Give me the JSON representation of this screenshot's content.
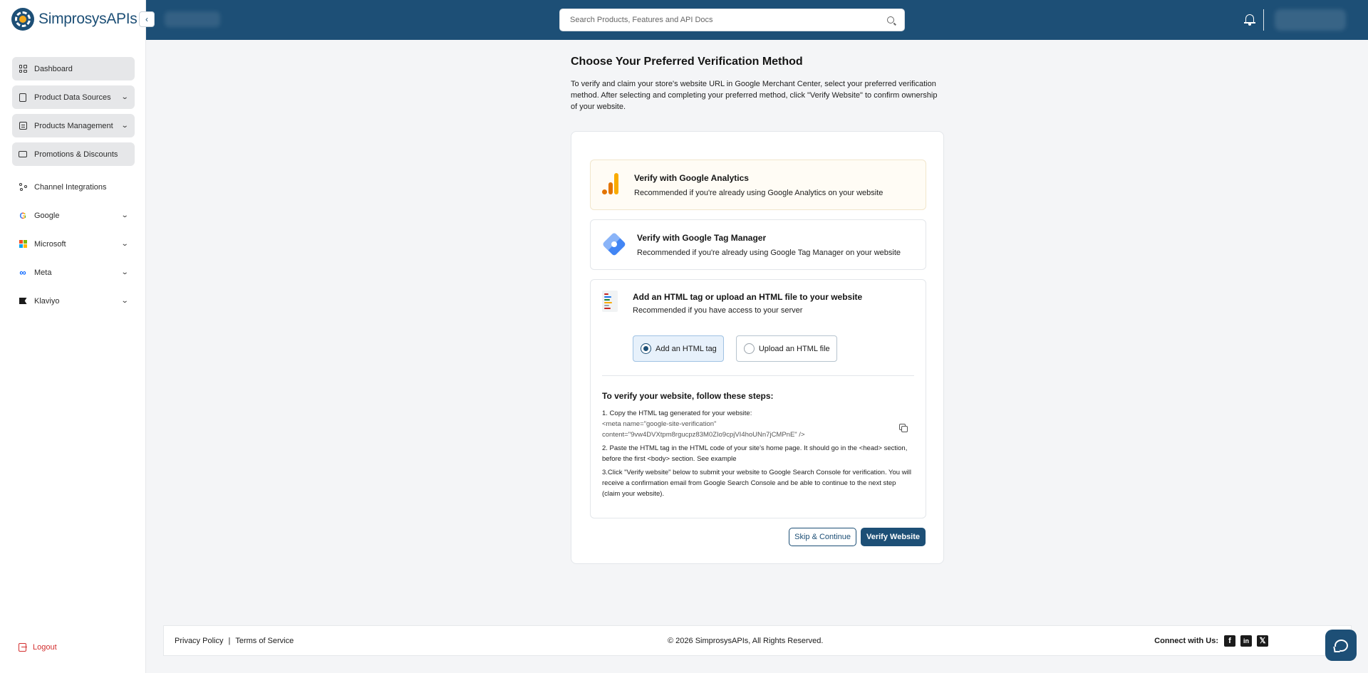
{
  "app": {
    "logo_text": "SimprosysAPIs"
  },
  "sidebar": {
    "items": [
      {
        "label": "Dashboard",
        "icon": "dashboard-icon",
        "expandable": false
      },
      {
        "label": "Product Data Sources",
        "icon": "document-icon",
        "expandable": true
      },
      {
        "label": "Products Management",
        "icon": "list-icon",
        "expandable": true
      },
      {
        "label": "Promotions & Discounts",
        "icon": "ticket-icon",
        "expandable": false
      },
      {
        "label": "Channel Integrations",
        "icon": "nodes-icon",
        "expandable": false
      },
      {
        "label": "Google",
        "icon": "google-logo",
        "expandable": true
      },
      {
        "label": "Microsoft",
        "icon": "microsoft-logo",
        "expandable": true
      },
      {
        "label": "Meta",
        "icon": "meta-logo",
        "expandable": true
      },
      {
        "label": "Klaviyo",
        "icon": "klaviyo-logo",
        "expandable": true
      }
    ],
    "logout_label": "Logout"
  },
  "header": {
    "search_placeholder": "Search Products, Features and API Docs"
  },
  "main": {
    "title": "Choose Your Preferred Verification Method",
    "description": "To verify and claim your store's website URL in Google Merchant Center, select your preferred verification method. After selecting and completing your preferred method, click \"Verify Website\" to confirm ownership of your website.",
    "options": [
      {
        "title": "Verify with Google Analytics",
        "subtitle": "Recommended if you're already using Google Analytics on your website",
        "icon": "google-analytics-icon"
      },
      {
        "title": "Verify with Google Tag Manager",
        "subtitle": "Recommended if you're already using Google Tag Manager on your website",
        "icon": "google-tag-manager-icon"
      },
      {
        "title": "Add an HTML tag or upload an HTML file to your website",
        "subtitle": "Recommended if you have access to your server",
        "icon": "html-file-icon"
      }
    ],
    "html_methods": [
      {
        "label": "Add an HTML tag",
        "selected": true
      },
      {
        "label": "Upload an HTML file",
        "selected": false
      }
    ],
    "steps": {
      "title": "To verify your website, follow these steps:",
      "step1": "1. Copy the HTML tag generated for your website:",
      "code_line1": "<meta name=\"google-site-verification\"",
      "code_line2": "content=\"9vw4DVXtpm8rgucpz83M0ZIo9cpjVI4hoUNn7jCMPnE\" />",
      "step2": "2. Paste the HTML tag in the HTML code of your site's home page. It should go in the <head> section, before the first <body> section. See example",
      "step3": "3.Click \"Verify website\" below to submit your website to Google Search Console for verification. You will receive a confirmation email from Google Search Console and be able to continue to the next step (claim your website)."
    },
    "skip_label": "Skip & Continue",
    "verify_label": "Verify Website"
  },
  "footer": {
    "privacy": "Privacy Policy",
    "separator": "|",
    "terms": "Terms of Service",
    "copyright": "© 2026 SimprosysAPIs, All Rights Reserved.",
    "connect": "Connect with Us:",
    "social": [
      "facebook-icon",
      "linkedin-icon",
      "x-icon"
    ]
  },
  "colors": {
    "brand": "#1d4f76",
    "logout": "#d32f2f",
    "selected_option_bg": "#fffcf5"
  }
}
